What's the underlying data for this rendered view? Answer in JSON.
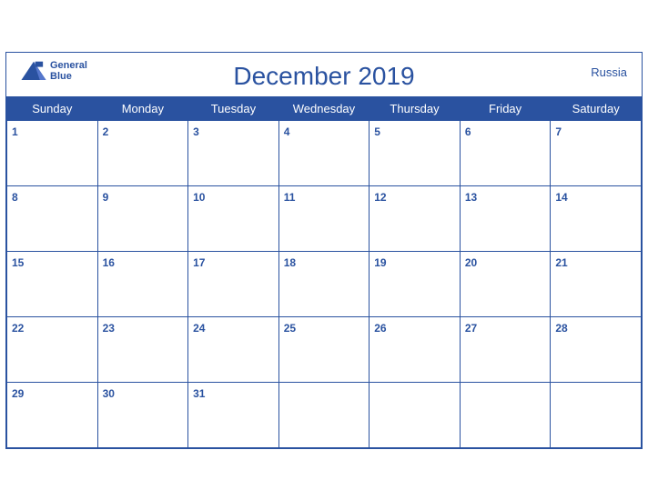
{
  "header": {
    "title": "December 2019",
    "country": "Russia",
    "logo": {
      "line1": "General",
      "line2": "Blue"
    }
  },
  "days_of_week": [
    "Sunday",
    "Monday",
    "Tuesday",
    "Wednesday",
    "Thursday",
    "Friday",
    "Saturday"
  ],
  "weeks": [
    [
      1,
      2,
      3,
      4,
      5,
      6,
      7
    ],
    [
      8,
      9,
      10,
      11,
      12,
      13,
      14
    ],
    [
      15,
      16,
      17,
      18,
      19,
      20,
      21
    ],
    [
      22,
      23,
      24,
      25,
      26,
      27,
      28
    ],
    [
      29,
      30,
      31,
      null,
      null,
      null,
      null
    ]
  ],
  "colors": {
    "blue": "#2a52a0",
    "white": "#ffffff"
  }
}
